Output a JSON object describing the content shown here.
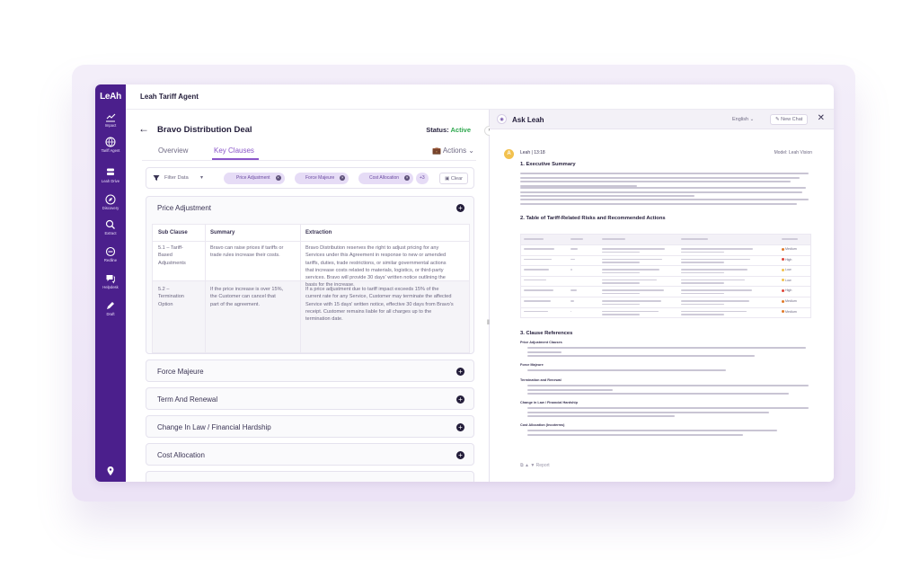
{
  "app": {
    "title": "Leah Tariff Agent",
    "logo": "LeAh"
  },
  "sidebar": {
    "items": [
      {
        "label": "Impact",
        "icon": "chart-icon"
      },
      {
        "label": "Tariff Agent",
        "icon": "globe-icon",
        "active": true
      },
      {
        "label": "Leah Drive",
        "icon": "drive-icon"
      },
      {
        "label": "Discovery",
        "icon": "compass-icon"
      },
      {
        "label": "Extract",
        "icon": "search-icon"
      },
      {
        "label": "Redline",
        "icon": "redline-icon"
      },
      {
        "label": "Helpdesk",
        "icon": "chat-icon"
      },
      {
        "label": "Draft",
        "icon": "pen-icon"
      }
    ]
  },
  "deal": {
    "title": "Bravo Distribution Deal",
    "status_label": "Status:",
    "status_value": "Active",
    "status_color": "#2fa84f"
  },
  "tabs": [
    {
      "label": "Overview"
    },
    {
      "label": "Key Clauses",
      "active": true
    }
  ],
  "actions_label": "Actions",
  "filter": {
    "label": "Filter Data",
    "chips": [
      "Price Adjustment",
      "Force Majeure",
      "Cost Allocation"
    ],
    "more": "+3",
    "clear": "Clear"
  },
  "price_adjustment": {
    "title": "Price Adjustment",
    "headers": [
      "Sub Clause",
      "Summary",
      "Extraction"
    ],
    "rows": [
      {
        "sub": [
          "5.1 – Tariff-",
          "Based",
          "Adjustments"
        ],
        "summary": [
          "Bravo can raise prices if tariffs or",
          "trade rules increase their costs."
        ],
        "extraction": [
          "Bravo Distribution reserves the right to adjust pricing for any",
          "Services under this Agreement in response to new or amended",
          "tariffs, duties, trade restrictions, or similar governmental actions",
          "that increase costs related to materials, logistics, or third-party",
          "services. Bravo will provide 30 days' written notice outlining the",
          "basis for the increase."
        ]
      },
      {
        "sub": [
          "5.2 –",
          "Termination",
          "Option"
        ],
        "summary": [
          "If the price increase is over 15%,",
          "the Customer can cancel that",
          "part of the agreement."
        ],
        "extraction": [
          "If a price adjustment due to tariff impact exceeds 15% of the",
          "current rate for any Service, Customer may terminate the affected",
          "Service with 15 days' written notice, effective 30 days from Bravo's",
          "receipt. Customer remains liable for all charges up to the",
          "termination date."
        ]
      }
    ]
  },
  "sections": [
    "Force Majeure",
    "Term And Renewal",
    "Change In Law / Financial Hardship",
    "Cost Allocation"
  ],
  "ask": {
    "title": "Ask Leah",
    "language": "English",
    "new_chat": "New Chat",
    "meta": "Leah  |  13:18",
    "model": "Model: Leah Vision",
    "h1": "1. Executive Summary",
    "h2": "2. Table of Tariff-Related Risks and Recommended Actions",
    "h3": "3. Clause References",
    "subheads": [
      "Price Adjustment Clauses",
      "Force Majeure",
      "Termination and Renewal",
      "Change in Law / Financial Hardship",
      "Cost Allocation (Incoterms)"
    ],
    "risk_levels": [
      "Medium",
      "High",
      "Low",
      "Low",
      "High",
      "Medium",
      "Medium"
    ],
    "risk_colors": {
      "High": "#e0453a",
      "Medium": "#e07a2a",
      "Low": "#f2c14e"
    },
    "feedback": "Report"
  }
}
